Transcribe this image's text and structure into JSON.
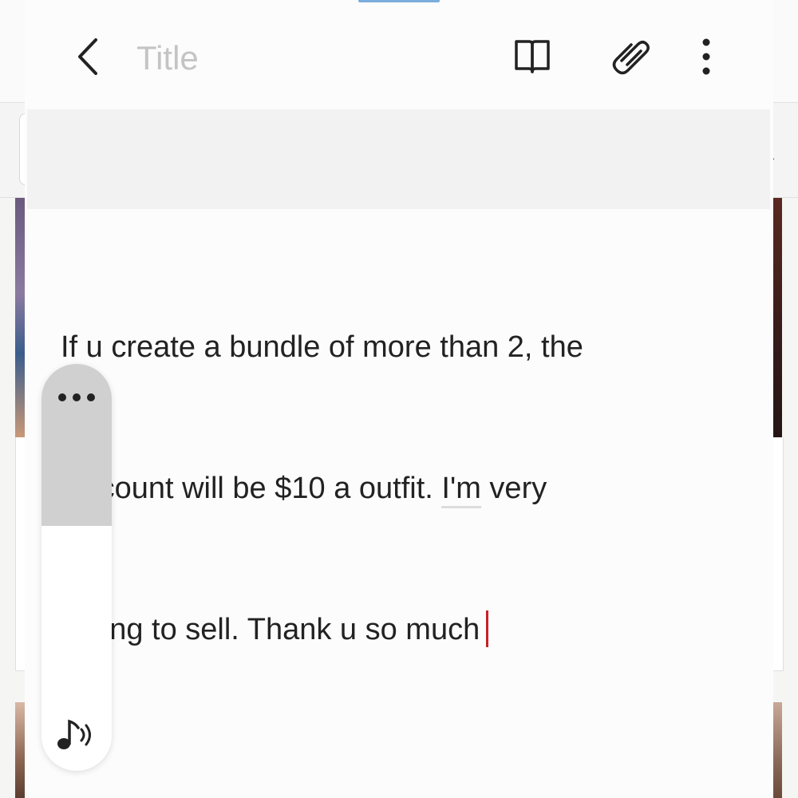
{
  "header": {
    "title_placeholder": "Title",
    "title_value": ""
  },
  "note": {
    "lines": [
      "If u create a bundle of more than 2, the",
      "discount will be $10 a outfit.  ",
      "I'm",
      " very",
      "willing to sell. Thank u so much"
    ]
  },
  "icons": {
    "back": "chevron-left-icon",
    "reader": "book-icon",
    "attach": "paperclip-icon",
    "more": "more-vertical-icon",
    "panel_more": "more-horizontal-icon",
    "panel_sound": "music-sound-icon"
  },
  "colors": {
    "cursor": "#c8202a",
    "accent_handle": "#7aaedc",
    "text": "#222222",
    "placeholder": "#c4c4c4"
  }
}
